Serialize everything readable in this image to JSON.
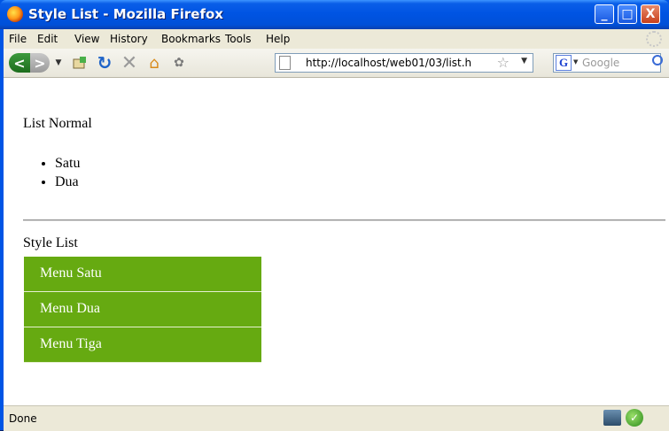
{
  "window": {
    "title": "Style List - Mozilla Firefox"
  },
  "window_controls": {
    "minimize": "_",
    "maximize": "□",
    "close": "X"
  },
  "menu": [
    "File",
    "Edit",
    "View",
    "History",
    "Bookmarks",
    "Tools",
    "Help"
  ],
  "navbar": {
    "back": "<",
    "forward": ">",
    "url": "http://localhost/web01/03/list.h",
    "search_engine_letter": "G",
    "search_placeholder": "Google"
  },
  "page": {
    "normal_title": "List Normal",
    "normal_items": [
      "Satu",
      "Dua"
    ],
    "style_title": "Style List",
    "style_items": [
      "Menu Satu",
      "Menu Dua",
      "Menu Tiga"
    ],
    "style_item_color": "#66aa11"
  },
  "status": {
    "text": "Done"
  }
}
